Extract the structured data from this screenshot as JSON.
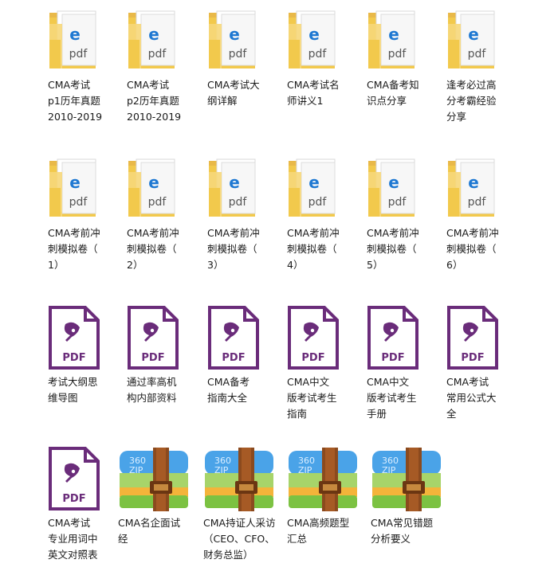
{
  "files": [
    {
      "icon": "folder-pdf-icon",
      "label": "CMA考试\np1历年真题\n2010-2019"
    },
    {
      "icon": "folder-pdf-icon",
      "label": "CMA考试\np2历年真题\n2010-2019"
    },
    {
      "icon": "folder-pdf-icon",
      "label": "CMA考试大\n纲详解"
    },
    {
      "icon": "folder-pdf-icon",
      "label": "CMA考试名\n师讲义1"
    },
    {
      "icon": "folder-pdf-icon",
      "label": "CMA备考知\n识点分享"
    },
    {
      "icon": "folder-pdf-icon",
      "label": "逢考必过高\n分考霸经验\n分享"
    },
    {
      "icon": "folder-pdf-icon",
      "label": "CMA考前冲\n刺模拟卷（\n1）"
    },
    {
      "icon": "folder-pdf-icon",
      "label": "CMA考前冲\n刺模拟卷（\n2）"
    },
    {
      "icon": "folder-pdf-icon",
      "label": "CMA考前冲\n刺模拟卷（\n3）"
    },
    {
      "icon": "folder-pdf-icon",
      "label": "CMA考前冲\n刺模拟卷（\n4）"
    },
    {
      "icon": "folder-pdf-icon",
      "label": "CMA考前冲\n刺模拟卷（\n5）"
    },
    {
      "icon": "folder-pdf-icon",
      "label": "CMA考前冲\n刺模拟卷（\n6）"
    },
    {
      "icon": "pdf-file-icon",
      "icon_text": "PDF",
      "label": "考试大纲思\n维导图"
    },
    {
      "icon": "pdf-file-icon",
      "icon_text": "PDF",
      "label": "通过率高机\n构内部资料"
    },
    {
      "icon": "pdf-file-icon",
      "icon_text": "PDF",
      "label": "CMA备考\n指南大全"
    },
    {
      "icon": "pdf-file-icon",
      "icon_text": "PDF",
      "label": "CMA中文\n版考试考生\n指南"
    },
    {
      "icon": "pdf-file-icon",
      "icon_text": "PDF",
      "label": "CMA中文\n版考试考生\n手册"
    },
    {
      "icon": "pdf-file-icon",
      "icon_text": "PDF",
      "label": "CMA考试\n常用公式大\n全"
    },
    {
      "icon": "pdf-file-icon",
      "icon_text": "PDF",
      "label": "CMA考试\n专业用词中\n英文对照表"
    },
    {
      "icon": "zip-archive-icon",
      "icon_text": "360 ZIP",
      "label": "CMA名企面试\n经"
    },
    {
      "icon": "zip-archive-icon",
      "icon_text": "360 ZIP",
      "label": "CMA持证人采访\n（CEO、CFO、\n财务总监）"
    },
    {
      "icon": "zip-archive-icon",
      "icon_text": "360 ZIP",
      "label": "CMA高频题型\n汇总"
    },
    {
      "icon": "zip-archive-icon",
      "icon_text": "360 ZIP",
      "label": "CMA常见错题\n分析要义"
    }
  ],
  "colors": {
    "folder": "#f2c94c",
    "pdf_purple": "#6a2c7a",
    "ie_blue": "#1e78d2",
    "zip_blue": "#4aa3e8",
    "zip_green": "#7cc242",
    "zip_strap": "#8b4a1e"
  }
}
